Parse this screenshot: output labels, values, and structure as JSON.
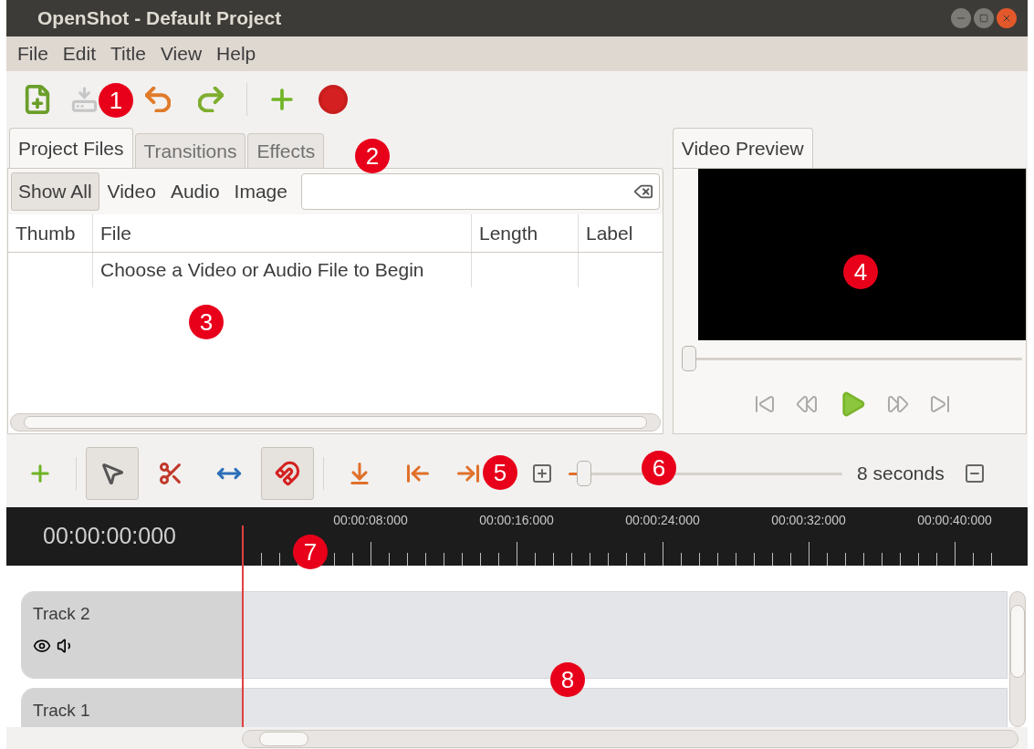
{
  "window": {
    "title": "OpenShot - Default Project"
  },
  "menu": [
    "File",
    "Edit",
    "Title",
    "View",
    "Help"
  ],
  "toolbar": [
    {
      "kind": "new",
      "disabled": false
    },
    {
      "kind": "save",
      "disabled": true
    },
    {
      "kind": "undo",
      "disabled": false
    },
    {
      "kind": "redo",
      "disabled": false
    },
    {
      "kind": "add",
      "disabled": false
    },
    {
      "kind": "record",
      "disabled": false
    }
  ],
  "tabs": [
    {
      "label": "Project Files",
      "selected": true
    },
    {
      "label": "Transitions",
      "selected": false
    },
    {
      "label": "Effects",
      "selected": false
    }
  ],
  "filters": [
    {
      "label": "Show All",
      "selected": true
    },
    {
      "label": "Video",
      "selected": false
    },
    {
      "label": "Audio",
      "selected": false
    },
    {
      "label": "Image",
      "selected": false
    }
  ],
  "table": {
    "columns": [
      "Thumb",
      "File",
      "Length",
      "Label"
    ],
    "rows": [
      [
        "",
        "Choose a Video or Audio File to Begin",
        "",
        ""
      ]
    ]
  },
  "preview": {
    "tab": "Video Preview",
    "seek": {
      "level": 0
    }
  },
  "timeline_tools": [
    {
      "kind": "add",
      "on": false
    },
    {
      "kind": "pointer",
      "on": true
    },
    {
      "kind": "razor",
      "on": false
    },
    {
      "kind": "resize",
      "on": false
    },
    {
      "kind": "snap",
      "on": true
    },
    {
      "kind": "marker",
      "on": false
    },
    {
      "kind": "prev",
      "on": false
    },
    {
      "kind": "next",
      "on": false
    }
  ],
  "zoom": {
    "level": 0.03,
    "reading": "8 seconds"
  },
  "ruler": {
    "time": "00:00:00:000",
    "labels": [
      "00:00:08:000",
      "00:00:16:000",
      "00:00:24:000",
      "00:00:32:000",
      "00:00:40:000"
    ]
  },
  "tracks": [
    {
      "name": "Track 2",
      "visible": true,
      "audible": true
    },
    {
      "name": "Track 1"
    }
  ],
  "callouts": [
    "1",
    "2",
    "3",
    "4",
    "5",
    "6",
    "7",
    "8"
  ]
}
